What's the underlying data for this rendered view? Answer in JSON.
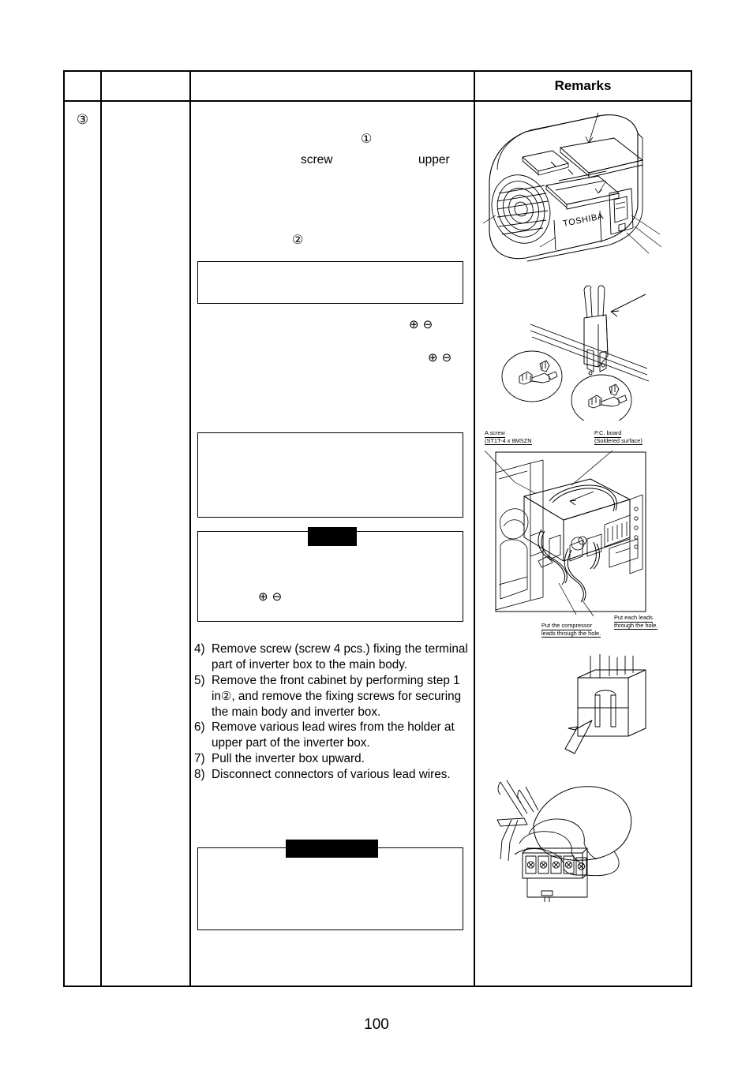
{
  "page": {
    "number": "100"
  },
  "table": {
    "headers": {
      "no": "",
      "part": "",
      "procedure": "",
      "remarks": "Remarks"
    },
    "row": {
      "step_number": "③"
    }
  },
  "procedure": {
    "circled_one": "①",
    "word_screw": "screw",
    "word_upper": "upper",
    "circled_two": "②",
    "plus_symbol": "⊕",
    "minus_symbol": "⊖",
    "steps": [
      {
        "marker": "4)",
        "text": "Remove screw (screw 4 pcs.) fixing the terminal part of inverter box to the main body."
      },
      {
        "marker": "5)",
        "text_before": "Remove the front cabinet by performing step 1 in",
        "circled": "②",
        "text_after": ", and remove the fixing screws for securing the main body and inverter box."
      },
      {
        "marker": "6)",
        "text": "Remove various lead wires from the holder at upper part of the inverter box."
      },
      {
        "marker": "7)",
        "text": "Pull the inverter box upward."
      },
      {
        "marker": "8)",
        "text": "Disconnect connectors of various lead wires."
      }
    ]
  },
  "remarks": {
    "figures": [
      {
        "name": "outdoor-unit-top-cabinet-exploded-view",
        "brand_text": "TOSHIBA"
      },
      {
        "name": "connector-terminal-detail-view"
      },
      {
        "name": "inverter-box-assembly-view",
        "labels": [
          {
            "line1": "A screw",
            "line2": "(ST1T-4 x 8MSZN"
          },
          {
            "line1": "P.C. board",
            "line2": "(Soldered surface)"
          },
          {
            "line1": "Put the compressor",
            "line2": "leads through the hole."
          },
          {
            "line1": "Put each leads",
            "line2": "through the hole."
          }
        ]
      },
      {
        "name": "lead-holder-release-view"
      },
      {
        "name": "hand-removing-leads-from-terminal-block-view"
      }
    ]
  },
  "colors": {
    "ink": "#000000",
    "paper": "#ffffff"
  }
}
